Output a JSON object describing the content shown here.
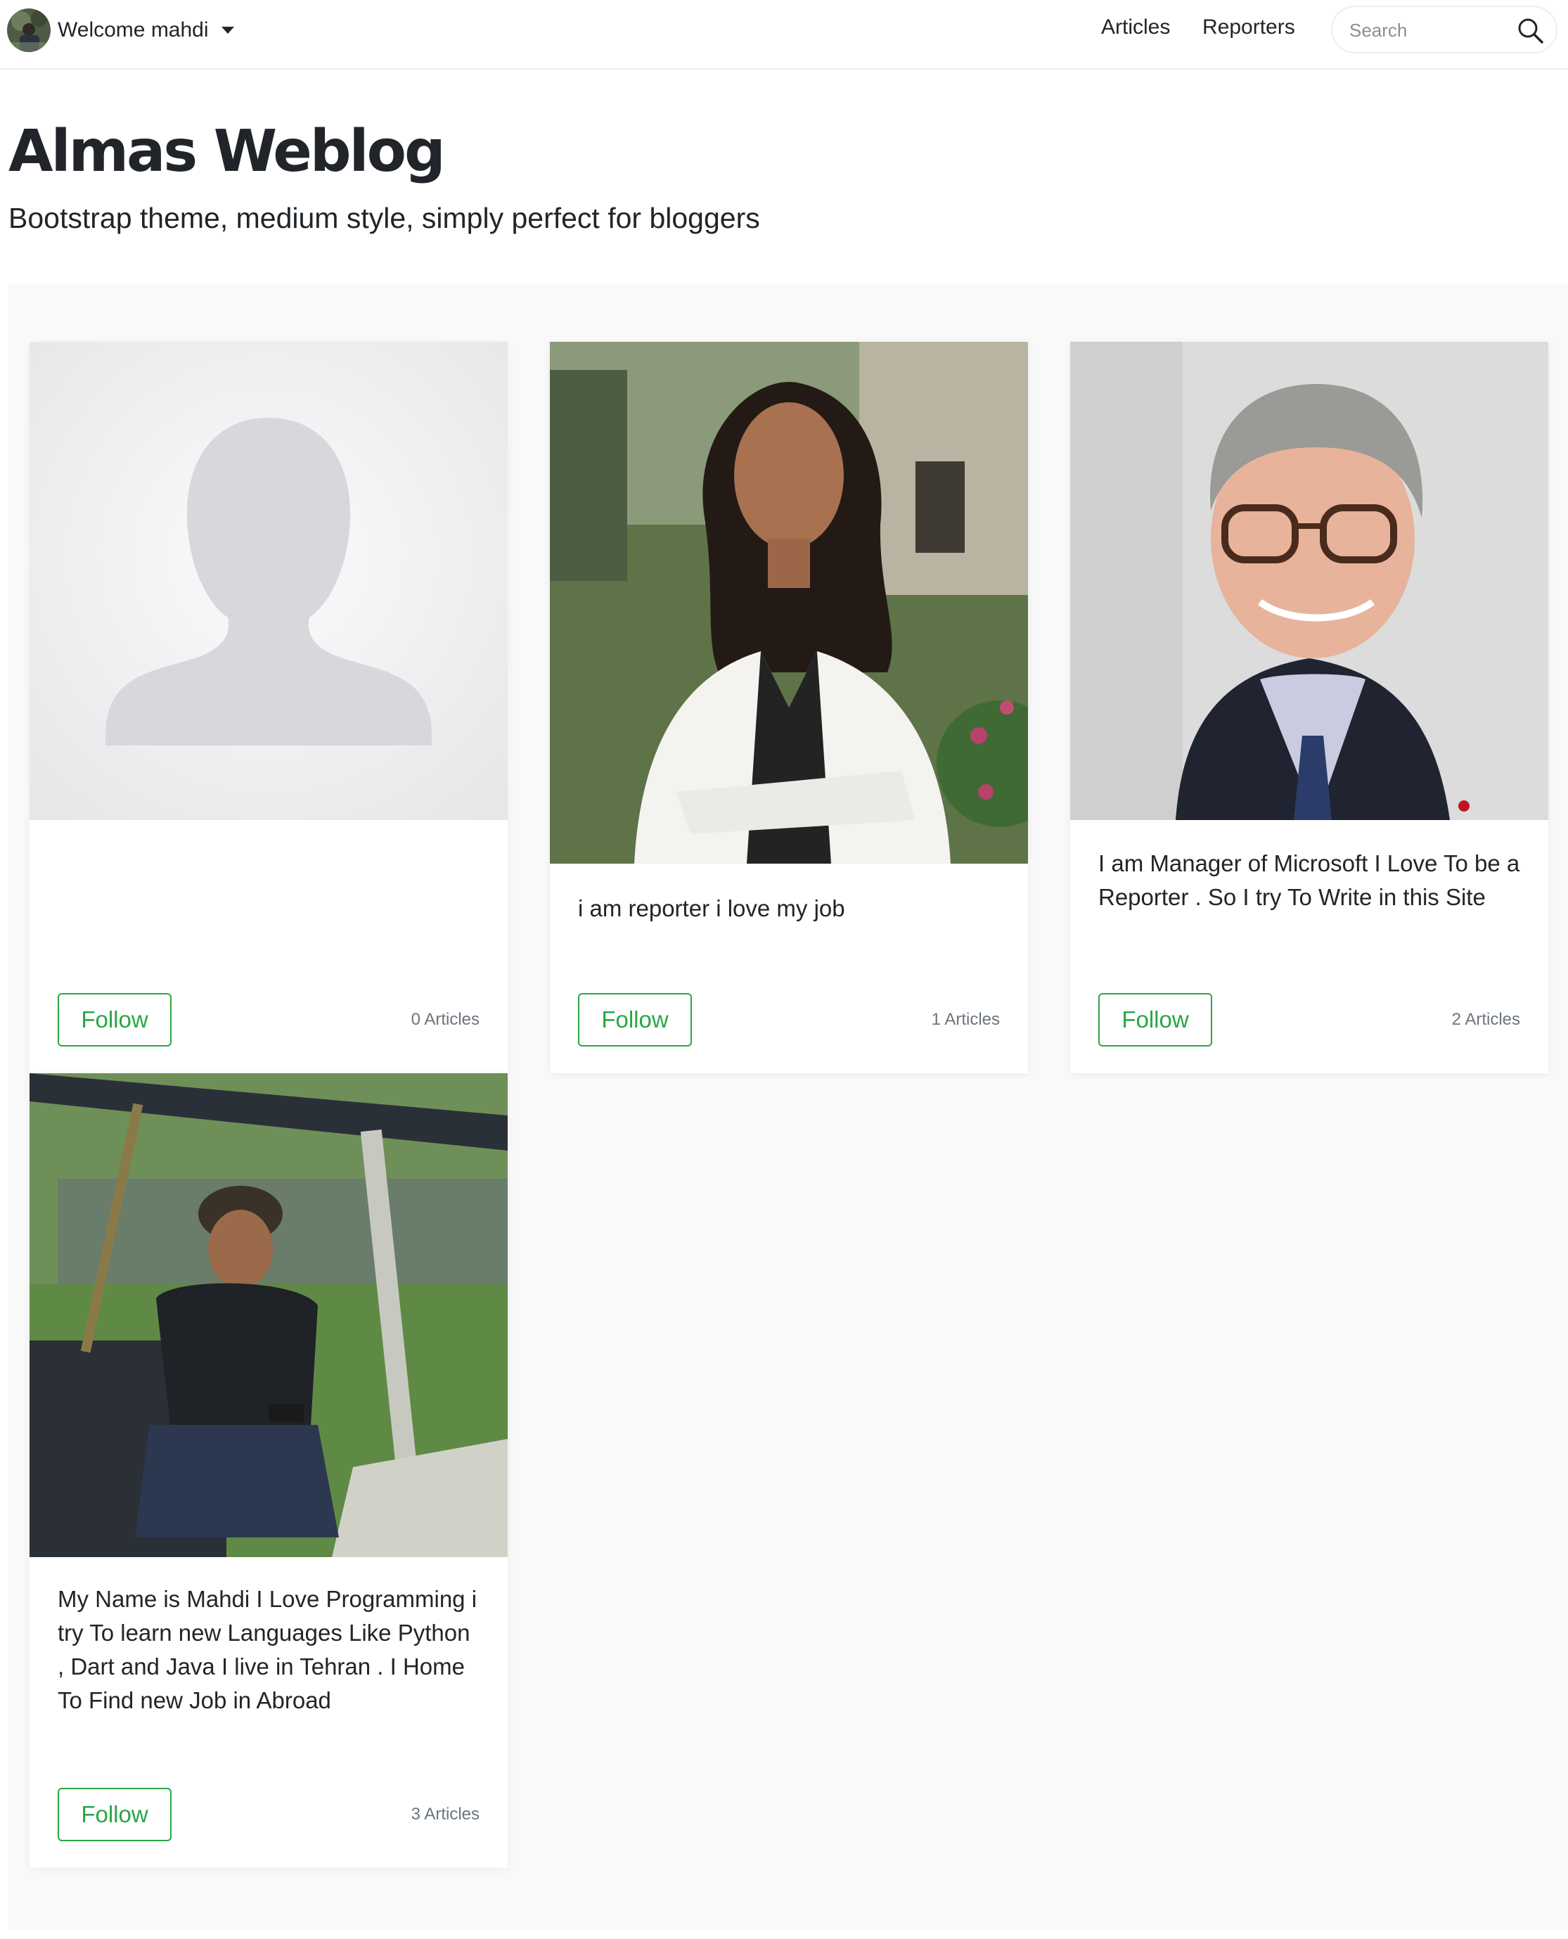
{
  "nav": {
    "welcome_label": "Welcome mahdi",
    "links": [
      "Articles",
      "Reporters"
    ],
    "search_placeholder": "Search"
  },
  "hero": {
    "title": "Almas Weblog",
    "tagline": "Bootstrap theme, medium style, simply perfect for bloggers"
  },
  "theme": {
    "accent": "#28a745",
    "section_bg": "#f9f9f9",
    "muted": "#6c757d"
  },
  "reporters": [
    {
      "photo": "default-avatar-silhouette",
      "bio": "",
      "follow_label": "Follow",
      "articles": "0 Articles"
    },
    {
      "photo": "woman-reporter-photo",
      "bio": "i am reporter i love my job",
      "follow_label": "Follow",
      "articles": "1 Articles"
    },
    {
      "photo": "man-with-glasses-photo",
      "bio": "I am Manager of Microsoft I Love To be a Reporter . So I try To Write in this Site",
      "follow_label": "Follow",
      "articles": "2 Articles"
    },
    {
      "photo": "man-in-vehicle-photo",
      "bio": "My Name is Mahdi I Love Programming i try To learn new Languages Like Python , Dart and Java I live in Tehran . I Home To Find new Job in Abroad",
      "follow_label": "Follow",
      "articles": "3 Articles"
    }
  ]
}
